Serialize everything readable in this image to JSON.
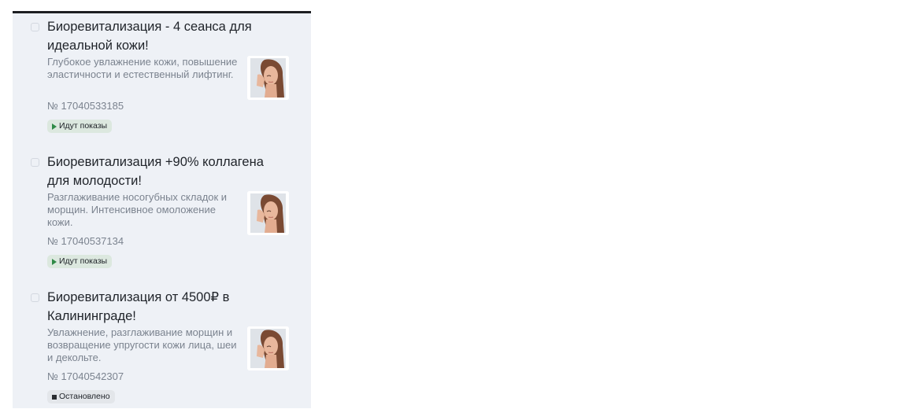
{
  "ads": [
    {
      "title": "Биоревитализация - 4 сеанса для идеальной кожи!",
      "description": "Глубокое увлажнение кожи, повышение эластичности и естественный лифтинг.",
      "id_text": "№ 17040533185",
      "status": "Идут показы",
      "status_icon": "play-icon",
      "thumbnail": "woman-face-photo"
    },
    {
      "title": "Биоревитализация +90% коллагена для молодости!",
      "description": "Разглаживание носогубных складок и морщин. Интенсивное омоложение кожи.",
      "id_text": "№ 17040537134",
      "status": "Идут показы",
      "status_icon": "play-icon",
      "thumbnail": "woman-face-photo"
    },
    {
      "title": "Биоревитализация от 4500₽ в Калининграде!",
      "description": "Увлажнение, разглаживание морщин и возвращение упругости кожи лица, шеи и декольте.",
      "id_text": "№ 17040542307",
      "status": "Остановлено",
      "status_icon": "stop-icon",
      "thumbnail": "woman-face-photo"
    }
  ],
  "colors": {
    "panel_bg": "#eef1f6",
    "running_accent": "#2f8a47",
    "text_primary": "#1f2329",
    "text_secondary": "#7b838f"
  }
}
